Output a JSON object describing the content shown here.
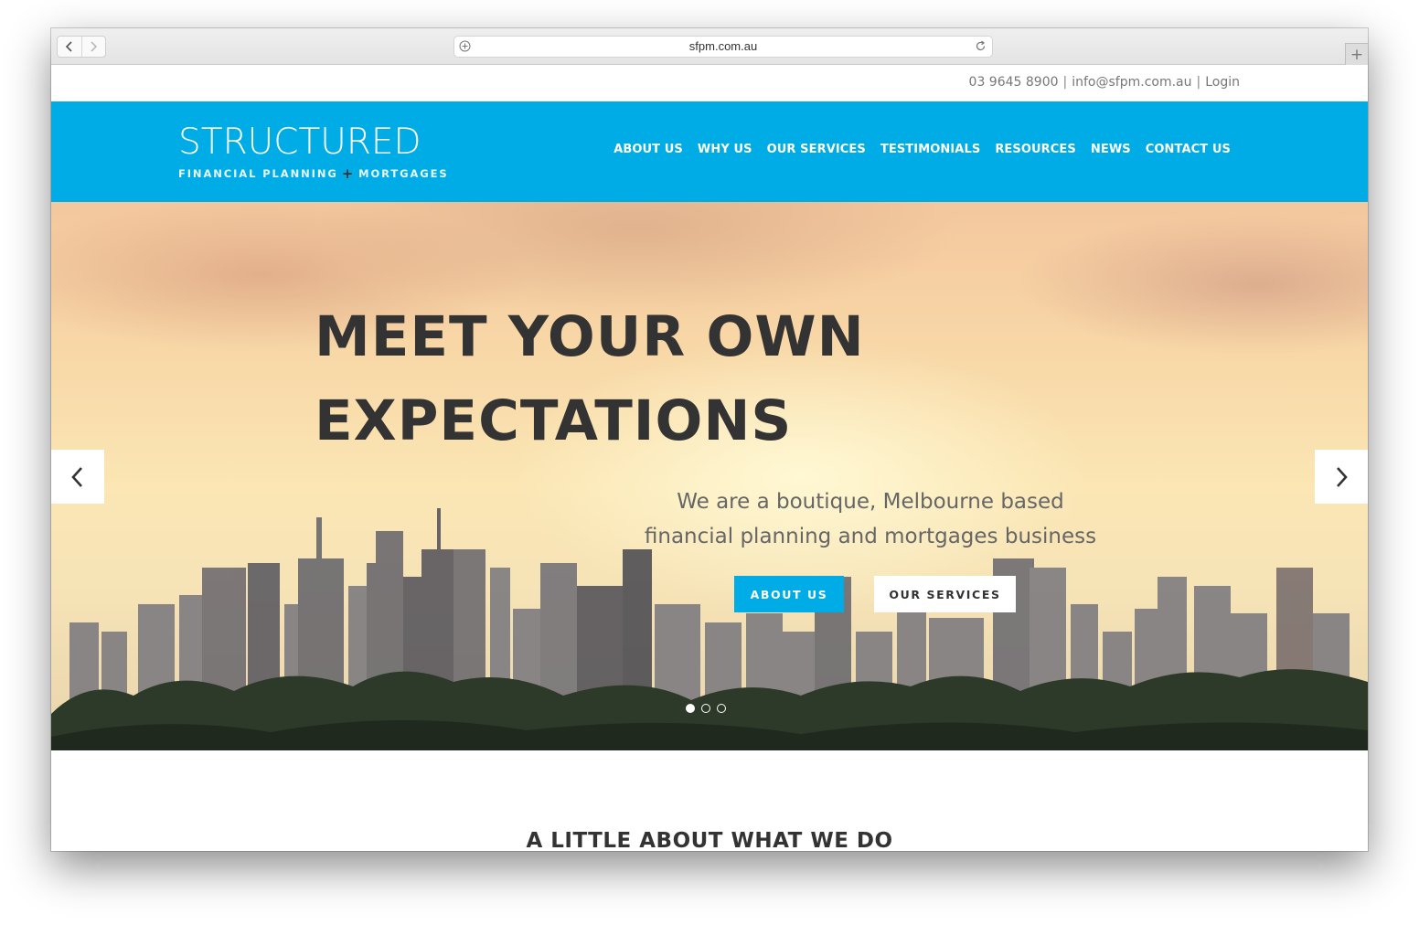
{
  "browser": {
    "url": "sfpm.com.au",
    "back_icon": "chevron-left-icon",
    "forward_icon": "chevron-right-icon",
    "new_tab_label": "+"
  },
  "topbar": {
    "phone": "03 9645 8900",
    "email": "info@sfpm.com.au",
    "login": "Login",
    "separator": "|"
  },
  "header": {
    "logo_main": "STRUCTURED",
    "logo_sub_left": "FINANCIAL PLANNING",
    "logo_sub_plus": "+",
    "logo_sub_right": "MORTGAGES",
    "nav": [
      "ABOUT US",
      "WHY US",
      "OUR SERVICES",
      "TESTIMONIALS",
      "RESOURCES",
      "NEWS",
      "CONTACT US"
    ],
    "bg_color": "#00ace6"
  },
  "hero": {
    "headline_line1": "MEET YOUR OWN",
    "headline_line2": "EXPECTATIONS",
    "tagline_line1": "We are a boutique, Melbourne based",
    "tagline_line2": "financial planning and mortgages business",
    "button_primary": "ABOUT US",
    "button_secondary": "OUR SERVICES",
    "slides_total": 3,
    "active_slide": 1
  },
  "section": {
    "title": "A LITTLE ABOUT WHAT WE DO"
  }
}
